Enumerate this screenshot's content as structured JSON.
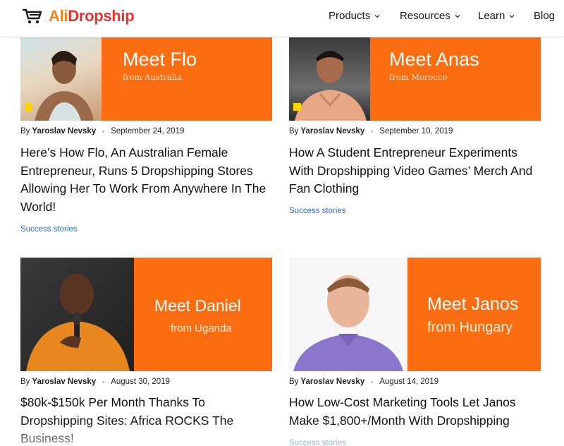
{
  "brand": {
    "ali": "Ali",
    "drop": "Dropship"
  },
  "nav": [
    {
      "label": "Products",
      "dropdown": true
    },
    {
      "label": "Resources",
      "dropdown": true
    },
    {
      "label": "Learn",
      "dropdown": true
    },
    {
      "label": "Blog",
      "dropdown": false
    }
  ],
  "posts": [
    {
      "meet": "Meet Flo",
      "from": "from Australia",
      "author_prefix": "By",
      "author": "Yaroslav Nevsky",
      "date": "September 24, 2019",
      "title": "Here’s How Flo, An Australian Female Entrepreneur, Runs 5 Dropshipping Stores Allowing Her To Work From Anywhere In The World!",
      "category": "Success stories"
    },
    {
      "meet": "Meet Anas",
      "from": "from Morocco",
      "author_prefix": "By",
      "author": "Yaroslav Nevsky",
      "date": "September 10, 2019",
      "title": "How A Student Entrepreneur Experiments With Dropshipping Video Games’ Merch And Fan Clothing",
      "category": "Success stories"
    },
    {
      "meet": "Meet Daniel",
      "from": "from Uganda",
      "author_prefix": "By",
      "author": "Yaroslav Nevsky",
      "date": "August 30, 2019",
      "title": "$80k-$150k Per Month Thanks To Dropshipping Sites: Africa ROCKS The Business!",
      "category": ""
    },
    {
      "meet": "Meet Janos",
      "from": "from Hungary",
      "author_prefix": "By",
      "author": "Yaroslav Nevsky",
      "date": "August 14, 2019",
      "title": "How Low-Cost Marketing Tools Let Janos Make $1,800+/Month With Dropshipping",
      "category": "Success stories"
    }
  ],
  "colors": {
    "orange_banner": "#fb6d10",
    "accent_square": "#ffd200",
    "category_link": "#2e6bc4"
  }
}
